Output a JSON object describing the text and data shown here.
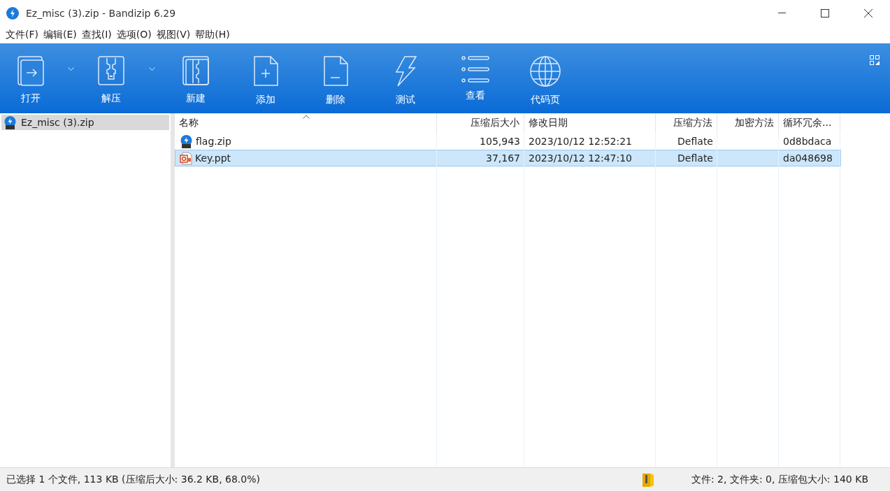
{
  "window": {
    "title": "Ez_misc (3).zip - Bandizip 6.29"
  },
  "menu": [
    "文件(F)",
    "编辑(E)",
    "查找(I)",
    "选项(O)",
    "视图(V)",
    "帮助(H)"
  ],
  "toolbar": [
    {
      "kind": "open",
      "label": "打开"
    },
    {
      "kind": "dropdown"
    },
    {
      "kind": "extract",
      "label": "解压"
    },
    {
      "kind": "dropdown"
    },
    {
      "kind": "new",
      "label": "新建"
    },
    {
      "kind": "add",
      "label": "添加"
    },
    {
      "kind": "delete",
      "label": "删除"
    },
    {
      "kind": "test",
      "label": "测试"
    },
    {
      "kind": "view",
      "label": "查看"
    },
    {
      "kind": "codepage",
      "label": "代码页"
    }
  ],
  "sidebar": {
    "items": [
      {
        "label": "Ez_misc (3).zip",
        "selected": true
      }
    ]
  },
  "table": {
    "columns": [
      "名称",
      "压缩后大小",
      "修改日期",
      "压缩方法",
      "加密方法",
      "循环冗余..."
    ],
    "rows": [
      {
        "kind": "zip",
        "selected": false,
        "cells": [
          "flag.zip",
          "105,943",
          "2023/10/12 12:52:21",
          "Deflate",
          "",
          "0d8bdaca"
        ]
      },
      {
        "kind": "ppt",
        "selected": true,
        "cells": [
          "Key.ppt",
          "37,167",
          "2023/10/12 12:47:10",
          "Deflate",
          "",
          "da048698"
        ]
      }
    ]
  },
  "status_bar": {
    "left": "已选择 1 个文件, 113 KB (压缩后大小: 36.2 KB, 68.0%)",
    "right": "文件: 2, 文件夹: 0, 压缩包大小: 140 KB"
  }
}
